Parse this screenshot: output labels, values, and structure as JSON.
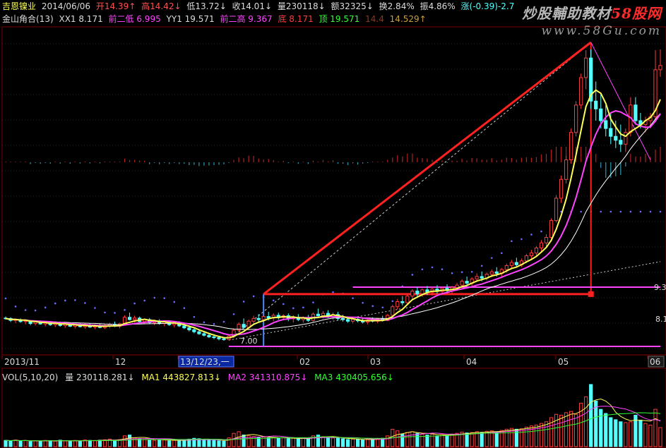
{
  "header": {
    "name": "吉恩镍业",
    "date": "2014/06/06",
    "open": "开14.39↑",
    "high": "高14.42↓",
    "low": "低13.72↓",
    "close": "收14.01↓",
    "volume": "量230118↓",
    "amount": "额32325↓",
    "turnover": "换2.84%",
    "amplitude": "振4.86%",
    "change": "涨(-0.39)-2.7"
  },
  "indicator": {
    "name": "金山角合(13)",
    "xx1": "XX1 8.171",
    "prev_low": "前二低 6.995",
    "yy1": "YY1 19.571",
    "prev_high": "前二高 9.367",
    "bottom": "底 8.171",
    "top": "顶 19.571",
    "v1": "14.4",
    "v2": "14.529↑"
  },
  "watermark": {
    "line1_a": "炒股輔助教材",
    "line1_b": "58股网",
    "line2": "www.58Gu.com"
  },
  "volume_header": {
    "name": "VOL(5,10,20)",
    "vol": "量 230118.281↓",
    "ma1": "MA1 443827.813↓",
    "ma2": "MA2 341310.875↓",
    "ma3": "MA3 430405.656↓"
  },
  "colors": {
    "up": "#ff3c3c",
    "down": "#54ffff",
    "ma5": "#ffff55",
    "ma10": "#ff44ff",
    "ma20": "#ffffff",
    "label_red": "#ff5050",
    "label_green": "#33ff33",
    "header_name": "#ffff55",
    "watermark_red": "#ff2a2a"
  },
  "chart_data": {
    "type": "candlestick",
    "price_labels": [
      "9.3",
      "8.1",
      "7.00"
    ],
    "x_ticks": [
      "2013/11",
      "12",
      "13/12/23,一",
      "02",
      "03",
      "04",
      "05",
      "06"
    ],
    "candles": [
      [
        7.56,
        7.6,
        7.52,
        7.55
      ],
      [
        7.55,
        7.58,
        7.46,
        7.5
      ],
      [
        7.5,
        7.54,
        7.43,
        7.52
      ],
      [
        7.52,
        7.55,
        7.44,
        7.47
      ],
      [
        7.47,
        7.51,
        7.4,
        7.49
      ],
      [
        7.49,
        7.51,
        7.38,
        7.42
      ],
      [
        7.42,
        7.48,
        7.37,
        7.46
      ],
      [
        7.46,
        7.5,
        7.39,
        7.41
      ],
      [
        7.41,
        7.47,
        7.35,
        7.45
      ],
      [
        7.45,
        7.48,
        7.36,
        7.39
      ],
      [
        7.39,
        7.45,
        7.33,
        7.43
      ],
      [
        7.43,
        7.47,
        7.34,
        7.37
      ],
      [
        7.37,
        7.44,
        7.31,
        7.41
      ],
      [
        7.41,
        7.45,
        7.33,
        7.35
      ],
      [
        7.35,
        7.42,
        7.3,
        7.39
      ],
      [
        7.39,
        7.44,
        7.32,
        7.34
      ],
      [
        7.34,
        7.42,
        7.29,
        7.38
      ],
      [
        7.38,
        7.43,
        7.31,
        7.33
      ],
      [
        7.33,
        7.4,
        7.28,
        7.37
      ],
      [
        7.37,
        7.42,
        7.3,
        7.32
      ],
      [
        7.32,
        7.41,
        7.28,
        7.36
      ],
      [
        7.36,
        7.44,
        7.31,
        7.4
      ],
      [
        7.4,
        7.47,
        7.33,
        7.35
      ],
      [
        7.35,
        7.44,
        7.3,
        7.41
      ],
      [
        7.41,
        7.63,
        7.38,
        7.58
      ],
      [
        7.58,
        7.7,
        7.5,
        7.52
      ],
      [
        7.52,
        7.62,
        7.45,
        7.56
      ],
      [
        7.56,
        7.6,
        7.44,
        7.47
      ],
      [
        7.47,
        7.55,
        7.4,
        7.52
      ],
      [
        7.52,
        7.56,
        7.41,
        7.44
      ],
      [
        7.44,
        7.52,
        7.38,
        7.49
      ],
      [
        7.49,
        7.53,
        7.39,
        7.42
      ],
      [
        7.42,
        7.49,
        7.35,
        7.46
      ],
      [
        7.46,
        7.5,
        7.36,
        7.39
      ],
      [
        7.39,
        7.46,
        7.32,
        7.43
      ],
      [
        7.43,
        7.48,
        7.33,
        7.36
      ],
      [
        7.36,
        7.42,
        7.28,
        7.31
      ],
      [
        7.31,
        7.38,
        7.22,
        7.26
      ],
      [
        7.26,
        7.33,
        7.17,
        7.21
      ],
      [
        7.21,
        7.27,
        7.13,
        7.16
      ],
      [
        7.16,
        7.23,
        7.09,
        7.12
      ],
      [
        7.12,
        7.18,
        7.05,
        7.08
      ],
      [
        7.08,
        7.15,
        7.02,
        7.06
      ],
      [
        7.06,
        7.11,
        6.99,
        7.03
      ],
      [
        7.03,
        7.08,
        6.98,
        7.01
      ],
      [
        7.01,
        7.12,
        6.995,
        7.1
      ],
      [
        7.1,
        7.3,
        7.05,
        7.25
      ],
      [
        7.25,
        7.45,
        7.2,
        7.4
      ],
      [
        7.4,
        7.55,
        7.28,
        7.32
      ],
      [
        7.32,
        7.52,
        7.28,
        7.48
      ],
      [
        7.48,
        7.62,
        7.4,
        7.55
      ],
      [
        7.55,
        7.66,
        7.47,
        7.52
      ],
      [
        7.52,
        7.64,
        7.45,
        7.6
      ],
      [
        7.6,
        7.72,
        7.5,
        7.56
      ],
      [
        7.56,
        7.68,
        7.48,
        7.63
      ],
      [
        7.63,
        7.7,
        7.52,
        7.57
      ],
      [
        7.57,
        7.66,
        7.5,
        7.62
      ],
      [
        7.62,
        7.68,
        7.48,
        7.54
      ],
      [
        7.54,
        7.63,
        7.45,
        7.58
      ],
      [
        7.58,
        7.66,
        7.48,
        7.52
      ],
      [
        7.52,
        7.6,
        7.44,
        7.57
      ],
      [
        7.57,
        7.64,
        7.46,
        7.5
      ],
      [
        7.5,
        7.7,
        7.47,
        7.66
      ],
      [
        7.66,
        7.8,
        7.58,
        7.62
      ],
      [
        7.62,
        7.74,
        7.55,
        7.68
      ],
      [
        7.68,
        7.76,
        7.56,
        7.6
      ],
      [
        7.6,
        7.7,
        7.52,
        7.65
      ],
      [
        7.65,
        7.72,
        7.5,
        7.55
      ],
      [
        7.55,
        7.64,
        7.47,
        7.52
      ],
      [
        7.52,
        7.58,
        7.44,
        7.48
      ],
      [
        7.48,
        7.56,
        7.42,
        7.53
      ],
      [
        7.53,
        7.6,
        7.45,
        7.49
      ],
      [
        7.49,
        7.57,
        7.42,
        7.46
      ],
      [
        7.46,
        7.54,
        7.4,
        7.51
      ],
      [
        7.51,
        7.58,
        7.45,
        7.48
      ],
      [
        7.48,
        7.56,
        7.43,
        7.54
      ],
      [
        7.54,
        7.62,
        7.47,
        7.5
      ],
      [
        7.5,
        7.66,
        7.48,
        7.63
      ],
      [
        7.63,
        7.9,
        7.6,
        7.85
      ],
      [
        7.85,
        8.05,
        7.78,
        7.98
      ],
      [
        7.98,
        8.12,
        7.88,
        7.95
      ],
      [
        7.95,
        8.18,
        7.9,
        8.12
      ],
      [
        8.12,
        8.3,
        8.05,
        8.25
      ],
      [
        8.25,
        8.35,
        8.1,
        8.18
      ],
      [
        8.18,
        8.32,
        8.1,
        8.28
      ],
      [
        8.28,
        8.38,
        8.15,
        8.22
      ],
      [
        8.22,
        8.36,
        8.14,
        8.3
      ],
      [
        8.3,
        8.4,
        8.18,
        8.24
      ],
      [
        8.24,
        8.36,
        8.16,
        8.32
      ],
      [
        8.32,
        8.42,
        8.2,
        8.26
      ],
      [
        8.26,
        8.38,
        8.18,
        8.34
      ],
      [
        8.34,
        8.46,
        8.25,
        8.4
      ],
      [
        8.4,
        8.55,
        8.32,
        8.5
      ],
      [
        8.5,
        8.62,
        8.4,
        8.45
      ],
      [
        8.45,
        8.6,
        8.38,
        8.56
      ],
      [
        8.56,
        8.7,
        8.48,
        8.62
      ],
      [
        8.62,
        8.75,
        8.5,
        8.58
      ],
      [
        8.58,
        8.72,
        8.52,
        8.68
      ],
      [
        8.68,
        8.8,
        8.6,
        8.74
      ],
      [
        8.74,
        8.86,
        8.62,
        8.7
      ],
      [
        8.7,
        8.84,
        8.6,
        8.8
      ],
      [
        8.8,
        8.95,
        8.72,
        8.9
      ],
      [
        8.9,
        9.05,
        8.82,
        8.98
      ],
      [
        8.98,
        9.1,
        8.85,
        8.92
      ],
      [
        8.92,
        9.08,
        8.86,
        9.02
      ],
      [
        9.02,
        9.2,
        8.96,
        9.15
      ],
      [
        9.15,
        9.3,
        9.05,
        9.22
      ],
      [
        9.22,
        9.4,
        9.12,
        9.35
      ],
      [
        9.35,
        9.55,
        9.25,
        9.48
      ],
      [
        9.48,
        9.7,
        9.38,
        9.62
      ],
      [
        9.62,
        10.1,
        9.58,
        10.05
      ],
      [
        10.05,
        10.7,
        10.0,
        10.62
      ],
      [
        10.62,
        11.2,
        10.5,
        11.1
      ],
      [
        11.1,
        11.7,
        11.0,
        11.6
      ],
      [
        11.6,
        12.4,
        11.5,
        12.3
      ],
      [
        12.3,
        13.1,
        12.2,
        13.0
      ],
      [
        13.0,
        13.8,
        12.9,
        13.7
      ],
      [
        13.7,
        14.4,
        13.4,
        14.2
      ],
      [
        14.2,
        14.42,
        12.9,
        13.1
      ],
      [
        13.1,
        13.6,
        12.6,
        12.9
      ],
      [
        12.9,
        13.3,
        12.4,
        12.6
      ],
      [
        12.6,
        13.0,
        12.2,
        12.4
      ],
      [
        12.4,
        12.8,
        12.0,
        12.2
      ],
      [
        12.2,
        12.6,
        11.9,
        12.1
      ],
      [
        12.1,
        12.5,
        11.8,
        12.0
      ],
      [
        12.0,
        12.4,
        11.8,
        12.3
      ],
      [
        12.3,
        13.2,
        12.2,
        13.0
      ],
      [
        13.0,
        13.2,
        12.5,
        12.6
      ],
      [
        12.6,
        12.8,
        12.4,
        12.5
      ],
      [
        12.5,
        12.7,
        12.3,
        12.6
      ],
      [
        12.6,
        12.8,
        12.4,
        12.7
      ],
      [
        12.7,
        14.4,
        12.6,
        13.9
      ],
      [
        13.9,
        14.42,
        13.72,
        14.01
      ]
    ],
    "volume": [
      150,
      140,
      160,
      130,
      150,
      120,
      140,
      135,
      150,
      145,
      130,
      155,
      140,
      135,
      150,
      130,
      160,
      150,
      145,
      155,
      165,
      180,
      150,
      170,
      260,
      280,
      210,
      190,
      170,
      160,
      150,
      170,
      160,
      140,
      150,
      140,
      165,
      180,
      200,
      190,
      170,
      160,
      150,
      140,
      130,
      210,
      320,
      360,
      280,
      260,
      240,
      220,
      230,
      210,
      220,
      200,
      210,
      190,
      200,
      180,
      200,
      190,
      260,
      280,
      240,
      220,
      210,
      200,
      190,
      170,
      180,
      170,
      160,
      180,
      170,
      190,
      200,
      260,
      420,
      380,
      300,
      340,
      360,
      320,
      300,
      280,
      300,
      260,
      290,
      270,
      300,
      320,
      350,
      330,
      340,
      360,
      340,
      370,
      380,
      360,
      390,
      420,
      440,
      420,
      430,
      470,
      500,
      520,
      560,
      600,
      700,
      780,
      760,
      820,
      850,
      780,
      1050,
      1200,
      1500,
      1100,
      900,
      800,
      700,
      650,
      600,
      580,
      600,
      760,
      640,
      560,
      520,
      900,
      460
    ],
    "volume_note": "relative scale, read from bar heights",
    "ylim": [
      6.8,
      14.6
    ]
  }
}
